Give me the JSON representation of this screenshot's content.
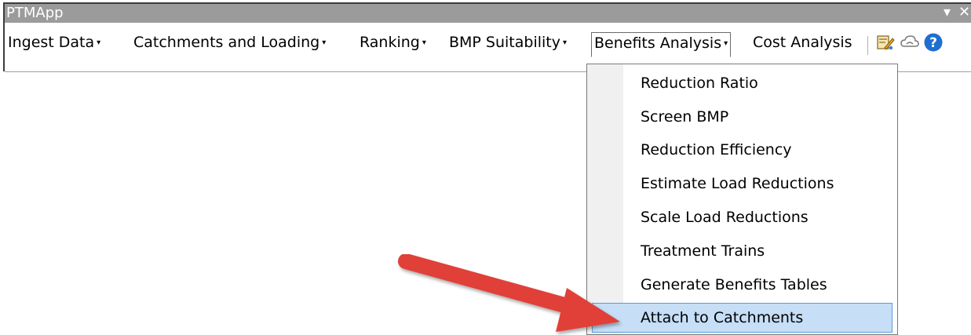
{
  "window": {
    "title": "PTMApp",
    "controls": [
      "▾",
      "✕"
    ]
  },
  "menubar": {
    "items": [
      {
        "label": "Ingest Data",
        "has_dropdown": true
      },
      {
        "label": "Catchments and Loading",
        "has_dropdown": true
      },
      {
        "label": "Ranking",
        "has_dropdown": true
      },
      {
        "label": "BMP Suitability",
        "has_dropdown": true
      },
      {
        "label": "Benefits Analysis",
        "has_dropdown": true,
        "open": true
      },
      {
        "label": "Cost Analysis",
        "has_dropdown": false
      }
    ],
    "caret": "▾"
  },
  "toolbar_icons": [
    "map-tool-icon",
    "cloud-link-icon",
    "help-icon"
  ],
  "dropdown": {
    "items": [
      {
        "label": "Reduction Ratio"
      },
      {
        "label": "Screen BMP"
      },
      {
        "label": "Reduction Efficiency"
      },
      {
        "label": "Estimate Load Reductions"
      },
      {
        "label": "Scale Load Reductions"
      },
      {
        "label": "Treatment Trains"
      },
      {
        "label": "Generate Benefits Tables"
      },
      {
        "label": "Attach to Catchments",
        "highlighted": true
      }
    ]
  },
  "annotation": {
    "type": "red-arrow",
    "target": "Attach to Catchments",
    "color": "#e04038"
  },
  "colors": {
    "titlebar": "#9b9b9b",
    "highlight": "#c6def6",
    "highlight_border": "#5a9bd8",
    "help_blue": "#1f6fd0"
  }
}
